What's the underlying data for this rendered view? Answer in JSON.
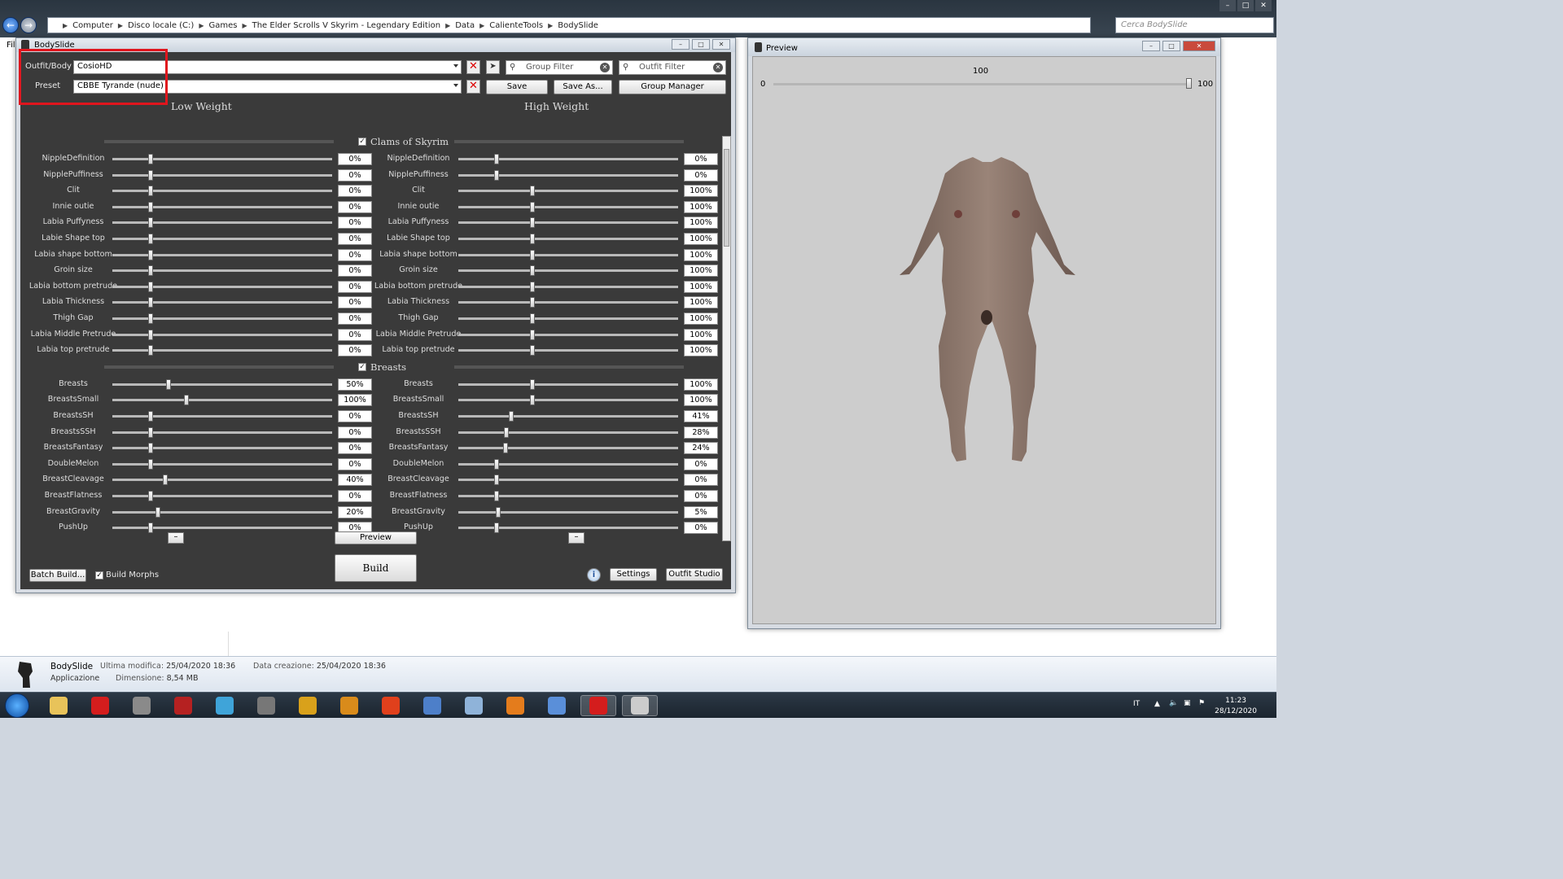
{
  "explorer": {
    "path": [
      "Computer",
      "Disco locale (C:)",
      "Games",
      "The Elder Scrolls V Skyrim - Legendary Edition",
      "Data",
      "CalienteTools",
      "BodySlide"
    ],
    "search_placeholder": "Cerca BodySlide",
    "menu_fragment": "Fil"
  },
  "bodyslide": {
    "title": "BodySlide",
    "outfit_label": "Outfit/Body",
    "outfit_value": "CosioHD",
    "preset_label": "Preset",
    "preset_value": "CBBE Tyrande (nude)",
    "group_filter_placeholder": "Group Filter",
    "outfit_filter_placeholder": "Outfit Filter",
    "save_label": "Save",
    "save_as_label": "Save As...",
    "group_manager_label": "Group Manager",
    "low_weight_header": "Low Weight",
    "high_weight_header": "High Weight",
    "minus_glyph": "–",
    "groups": [
      {
        "name": "Clams of Skyrim",
        "checked": true,
        "sliders": [
          {
            "name": "NippleDefinition",
            "low": 0,
            "high": 0
          },
          {
            "name": "NipplePuffiness",
            "low": 0,
            "high": 0
          },
          {
            "name": "Clit",
            "low": 0,
            "high": 100
          },
          {
            "name": "Innie outie",
            "low": 0,
            "high": 100
          },
          {
            "name": "Labia Puffyness",
            "low": 0,
            "high": 100
          },
          {
            "name": "Labie Shape top",
            "low": 0,
            "high": 100
          },
          {
            "name": "Labia shape bottom",
            "low": 0,
            "high": 100
          },
          {
            "name": "Groin size",
            "low": 0,
            "high": 100
          },
          {
            "name": "Labia bottom pretrude",
            "low": 0,
            "high": 100
          },
          {
            "name": "Labia Thickness",
            "low": 0,
            "high": 100
          },
          {
            "name": "Thigh Gap",
            "low": 0,
            "high": 100
          },
          {
            "name": "Labia Middle Pretrude",
            "low": 0,
            "high": 100
          },
          {
            "name": "Labia top pretrude",
            "low": 0,
            "high": 100
          }
        ]
      },
      {
        "name": "Breasts",
        "checked": true,
        "sliders": [
          {
            "name": "Breasts",
            "low": 50,
            "high": 100
          },
          {
            "name": "BreastsSmall",
            "low": 100,
            "high": 100
          },
          {
            "name": "BreastsSH",
            "low": 0,
            "high": 41
          },
          {
            "name": "BreastsSSH",
            "low": 0,
            "high": 28
          },
          {
            "name": "BreastsFantasy",
            "low": 0,
            "high": 24
          },
          {
            "name": "DoubleMelon",
            "low": 0,
            "high": 0
          },
          {
            "name": "BreastCleavage",
            "low": 40,
            "high": 0
          },
          {
            "name": "BreastFlatness",
            "low": 0,
            "high": 0
          },
          {
            "name": "BreastGravity",
            "low": 20,
            "high": 5
          },
          {
            "name": "PushUp",
            "low": 0,
            "high": 0
          }
        ]
      }
    ],
    "preview_label": "Preview",
    "build_label": "Build",
    "batch_build_label": "Batch Build...",
    "build_morphs_label": "Build Morphs",
    "build_morphs_checked": true,
    "info_glyph": "i",
    "settings_label": "Settings",
    "outfit_studio_label": "Outfit Studio"
  },
  "preview": {
    "title": "Preview",
    "weight_value": "100",
    "min_label": "0",
    "max_label": "100"
  },
  "details": {
    "name": "BodySlide",
    "type": "Applicazione",
    "modified_label": "Ultima modifica:",
    "modified_value": "25/04/2020 18:36",
    "size_label": "Dimensione:",
    "size_value": "8,54 MB",
    "created_label": "Data creazione:",
    "created_value": "25/04/2020 18:36"
  },
  "taskbar": {
    "apps": [
      "explorer-app",
      "opera-app",
      "media-app",
      "settings-app",
      "music-app",
      "audio-app",
      "tool-app",
      "chevron-app",
      "f-app",
      "ffdec-app",
      "window-app",
      "x-app",
      "pen-app",
      "opera-app-2",
      "bodyslide-app"
    ],
    "app_colors": [
      "#e8c35a",
      "#d41d1d",
      "#8a8a8a",
      "#b52121",
      "#3fa4d9",
      "#777777",
      "#d9a11b",
      "#d98b1b",
      "#e0401c",
      "#4d7fc9",
      "#8fb3d9",
      "#e47c1c",
      "#5a8fd9",
      "#d41d1d",
      "#cccccc"
    ],
    "language": "IT",
    "time": "11:23",
    "date": "28/12/2020"
  }
}
